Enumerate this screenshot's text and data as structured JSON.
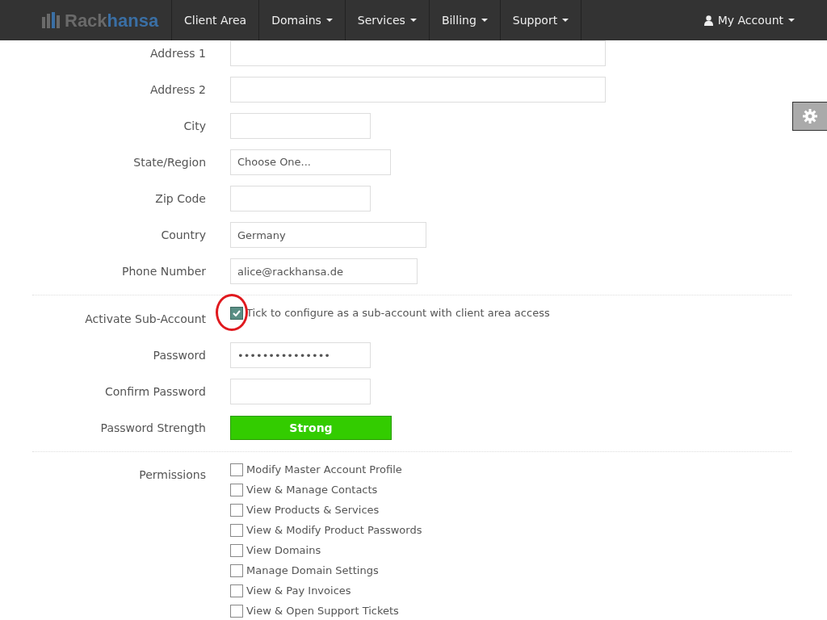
{
  "navbar": {
    "logo": [
      "Rack",
      "hansa"
    ],
    "items": [
      {
        "label": "Client Area",
        "dropdown": false
      },
      {
        "label": "Domains",
        "dropdown": true
      },
      {
        "label": "Services",
        "dropdown": true
      },
      {
        "label": "Billing",
        "dropdown": true
      },
      {
        "label": "Support",
        "dropdown": true
      }
    ],
    "account": {
      "label": "My Account",
      "dropdown": true
    }
  },
  "address_fields": [
    {
      "label": "Address 1",
      "kind": "input"
    },
    {
      "label": "Address 2",
      "kind": "input"
    },
    {
      "label": "City",
      "kind": "input"
    },
    {
      "label": "State/Region",
      "kind": "select",
      "value": "Choose One..."
    },
    {
      "label": "Zip Code",
      "kind": "input"
    },
    {
      "label": "Country",
      "kind": "input",
      "value": "Germany"
    },
    {
      "label": "Phone Number",
      "kind": "input",
      "value": "alice@rackhansa.de"
    }
  ],
  "sub_account": {
    "label": "Activate Sub-Account",
    "checked": true,
    "text": "Tick to configure as a sub-account with client area access",
    "circled": true
  },
  "password_fields": [
    {
      "label": "Password",
      "value": "•••••••••••••••"
    },
    {
      "label": "Confirm Password"
    }
  ],
  "password_strength": {
    "label": "Password Strength",
    "text": "Strong"
  },
  "permissions": {
    "label": "Permissions",
    "items": [
      {
        "label": "Modify Master Account Profile",
        "checked": false
      },
      {
        "label": "View & Manage Contacts",
        "checked": false
      },
      {
        "label": "View Products & Services",
        "checked": false
      },
      {
        "label": "View & Modify Product Passwords",
        "checked": false
      },
      {
        "label": "View Domains",
        "checked": false
      },
      {
        "label": "Manage Domain Settings",
        "checked": false
      },
      {
        "label": "View & Pay Invoices",
        "checked": false
      },
      {
        "label": "View & Open Support Tickets",
        "checked": false
      }
    ]
  }
}
